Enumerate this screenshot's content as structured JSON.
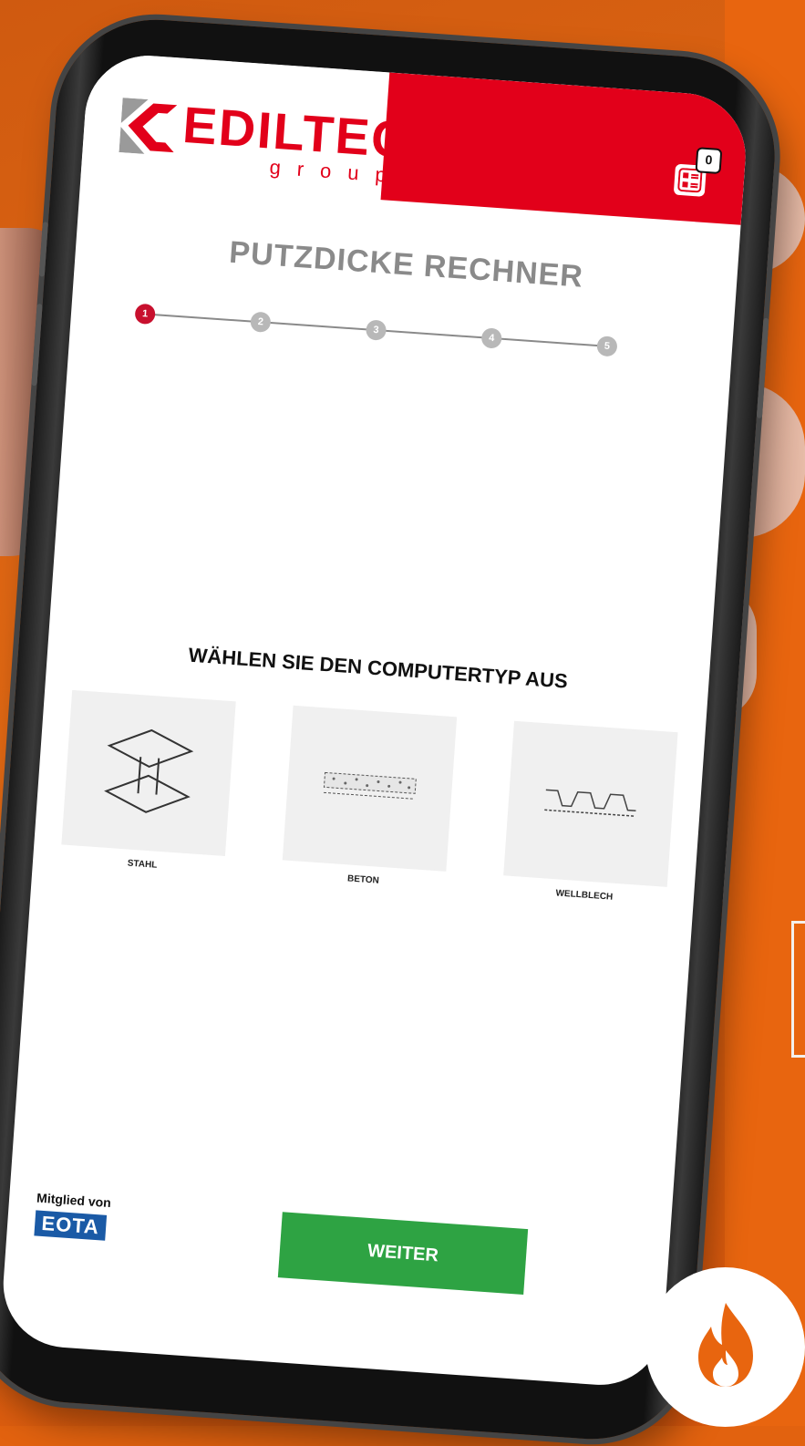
{
  "brand": {
    "name": "EDILTECO",
    "sub": "group",
    "primary_color": "#e2001a"
  },
  "header": {
    "cart_count": "0"
  },
  "page": {
    "title": "PUTZDICKE RECHNER"
  },
  "stepper": {
    "steps": [
      "1",
      "2",
      "3",
      "4",
      "5"
    ],
    "active_index": 0,
    "active_color": "#c8102e"
  },
  "selection": {
    "question": "WÄHLEN SIE DEN COMPUTERTYP AUS",
    "options": [
      {
        "label": "STAHL",
        "icon": "steel-beam-icon"
      },
      {
        "label": "BETON",
        "icon": "concrete-slab-icon"
      },
      {
        "label": "WELLBLECH",
        "icon": "corrugated-sheet-icon"
      }
    ]
  },
  "footer": {
    "member_label": "Mitglied von",
    "member_org": "EOTA",
    "next_label": "WEITER",
    "next_color": "#2ea343"
  },
  "decor": {
    "flame_icon": "flame-icon",
    "background_color": "#e2620f"
  }
}
